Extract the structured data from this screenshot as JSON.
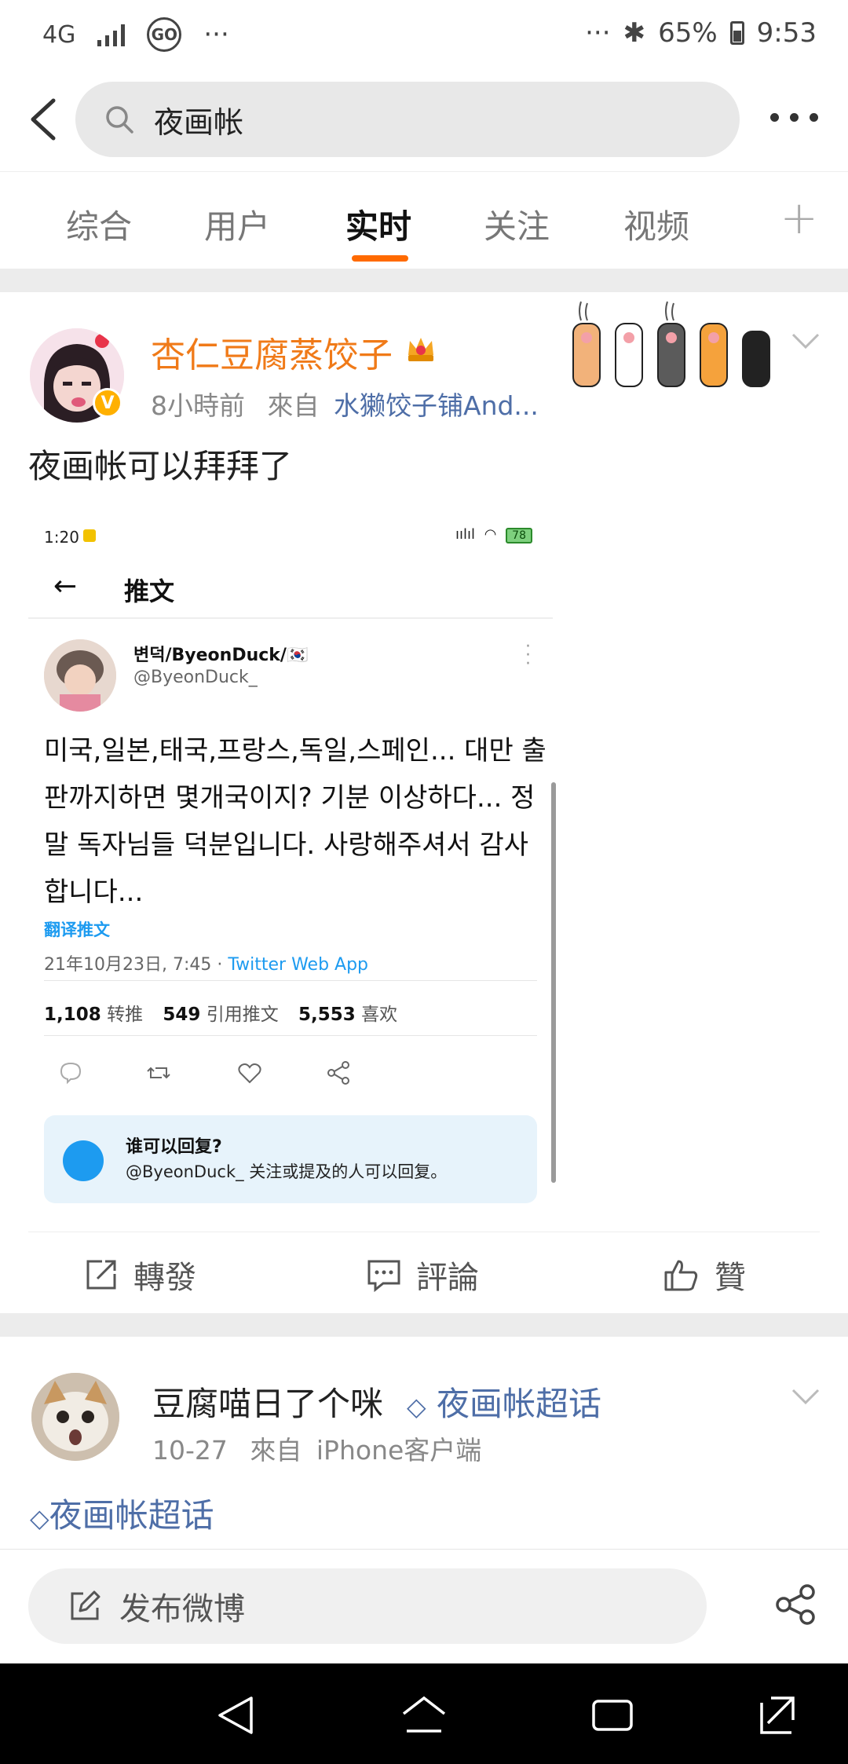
{
  "status_bar": {
    "network": "4G",
    "go": "GO",
    "dots_left": "···",
    "dots_right": "···",
    "bluetooth": "✱",
    "battery": "65%",
    "time": "9:53"
  },
  "search": {
    "query": "夜画帐"
  },
  "tabs": [
    {
      "label": "综合"
    },
    {
      "label": "用户"
    },
    {
      "label": "实时"
    },
    {
      "label": "关注"
    },
    {
      "label": "视频"
    }
  ],
  "post1": {
    "username": "杏仁豆腐蒸饺子",
    "time": "8小時前",
    "from_label": "來自",
    "source": "水獭饺子铺And...",
    "text": "夜画帐可以拜拜了",
    "embedded": {
      "time": "1:20",
      "battery": "78",
      "title": "推文",
      "name": "변덕/ByeonDuck/🇰🇷",
      "handle": "@ByeonDuck_",
      "body": "미국,일본,태국,프랑스,독일,스페인... 대만 출판까지하면 몇개국이지? 기분 이상하다... 정말 독자님들 덕분입니다. 사랑해주셔서 감사합니다...",
      "translate": "翻译推文",
      "date": "21年10月23日, 7:45 · ",
      "app": "Twitter Web App",
      "retweets_count": "1,108",
      "retweets_label": "转推",
      "quotes_count": "549",
      "quotes_label": "引用推文",
      "likes_count": "5,553",
      "likes_label": "喜欢",
      "reply_title": "谁可以回复?",
      "reply_text": "@ByeonDuck_ 关注或提及的人可以回复。"
    },
    "actions": {
      "repost": "轉發",
      "comment": "評論",
      "like": "贊"
    }
  },
  "post2": {
    "username": "豆腐喵日了个咪",
    "topic": "夜画帐超话",
    "date": "10-27",
    "from_label": "來自",
    "source": "iPhone客户端",
    "topic_line": "夜画帐超话"
  },
  "compose": {
    "label": "发布微博"
  },
  "colors": {
    "accent": "#ff6a00",
    "username": "#f07a18",
    "link": "#4e6ea7",
    "twitter_blue": "#1d9bf0"
  }
}
